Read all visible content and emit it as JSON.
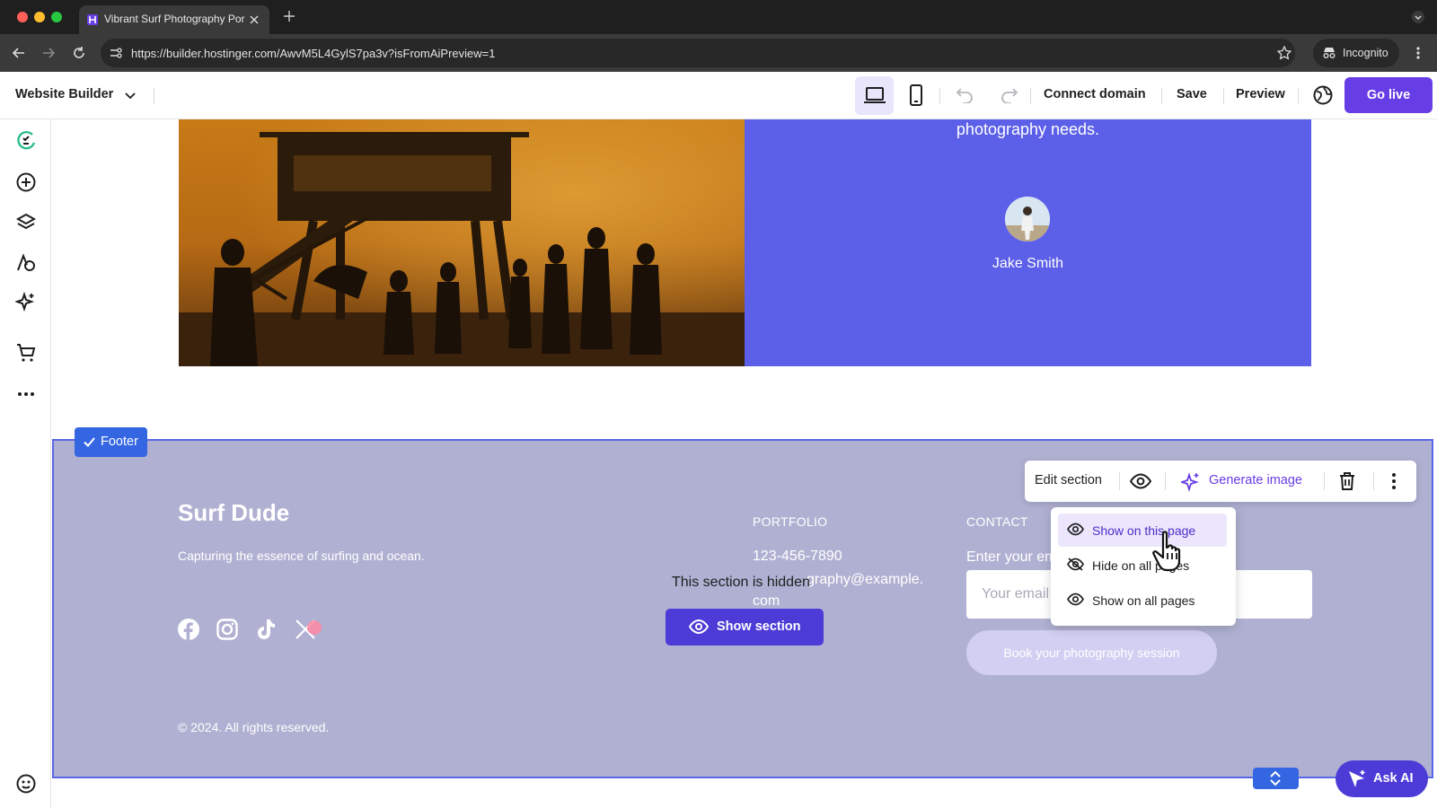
{
  "browser": {
    "tab_title": "Vibrant Surf Photography Por",
    "url": "https://builder.hostinger.com/AwvM5L4GylS7pa3v?isFromAiPreview=1",
    "incognito_label": "Incognito"
  },
  "topbar": {
    "app_menu_label": "Website Builder",
    "connect_domain": "Connect domain",
    "save": "Save",
    "preview": "Preview",
    "go_live": "Go live"
  },
  "sidebar": {
    "icons": [
      "ai-assistant-icon",
      "add-element-icon",
      "layers-icon",
      "styles-icon",
      "ai-tools-icon",
      "store-icon",
      "more-icon",
      "help-icon"
    ]
  },
  "testimonial": {
    "quote_tail": "photography needs.",
    "author": "Jake Smith"
  },
  "footer": {
    "tag": "Footer",
    "brand": "Surf Dude",
    "tagline": "Capturing the essence of surfing and ocean.",
    "portfolio_heading": "PORTFOLIO",
    "phone": "123-456-7890",
    "email_partial": "graphy@example.",
    "email_tail": "com",
    "contact_heading": "CONTACT",
    "enter_email_prefix": "Enter your em",
    "email_placeholder": "Your email",
    "book_button": "Book your photography session",
    "copyright": "© 2024. All rights reserved.",
    "hidden_notice": "This section is hidden",
    "show_section": "Show section",
    "social": [
      "facebook-icon",
      "instagram-icon",
      "tiktok-icon",
      "x-icon"
    ]
  },
  "section_toolbar": {
    "edit_section": "Edit section",
    "generate_image": "Generate image"
  },
  "visibility_menu": {
    "items": [
      "Show on this page",
      "Hide on all pages",
      "Show on all pages"
    ]
  },
  "ask_ai": "Ask AI",
  "colors": {
    "brand_purple": "#673de6",
    "panel_blue": "#5c5fe8",
    "footer_bg": "#b0b1d2",
    "selection_blue": "#3466e2"
  }
}
